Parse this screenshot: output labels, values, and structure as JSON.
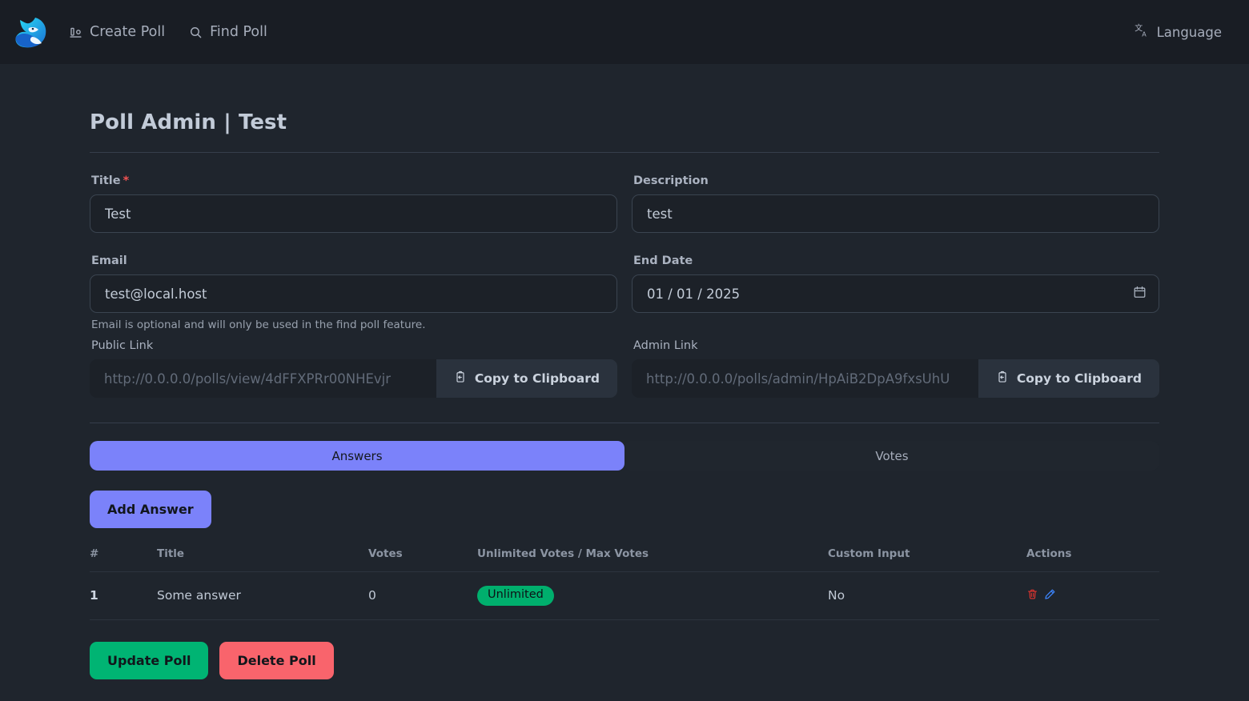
{
  "navbar": {
    "logo_name": "fox-logo",
    "links": [
      {
        "label": "Create Poll",
        "icon": "poll-bar-icon"
      },
      {
        "label": "Find Poll",
        "icon": "search-icon"
      }
    ],
    "language": {
      "label": "Language",
      "icon": "translate-icon"
    }
  },
  "page": {
    "title": "Poll Admin | Test"
  },
  "form": {
    "title": {
      "label": "Title",
      "required_marker": "*",
      "value": "Test",
      "placeholder": "Title"
    },
    "description": {
      "label": "Description",
      "value": "test",
      "placeholder": "Description"
    },
    "email": {
      "label": "Email",
      "value": "test@local.host",
      "placeholder": "Email",
      "helper": "Email is optional and will only be used in the find poll feature."
    },
    "end_date": {
      "label": "End Date",
      "value": "01 / 01 / 2025",
      "icon": "calendar-icon"
    },
    "public_link": {
      "label": "Public Link",
      "value": "http://0.0.0.0/polls/view/4dFFXPRr00NHEvjr",
      "copy_label": "Copy to Clipboard",
      "copy_icon": "clipboard-icon"
    },
    "admin_link": {
      "label": "Admin Link",
      "value": "http://0.0.0.0/polls/admin/HpAiB2DpA9fxsUhU",
      "copy_label": "Copy to Clipboard",
      "copy_icon": "clipboard-icon"
    }
  },
  "tabs": [
    {
      "label": "Answers",
      "active": true
    },
    {
      "label": "Votes",
      "active": false
    }
  ],
  "answers_panel": {
    "add_button": "Add Answer",
    "columns": [
      "#",
      "Title",
      "Votes",
      "Unlimited Votes / Max Votes",
      "Custom Input",
      "Actions"
    ],
    "rows": [
      {
        "index": "1",
        "title": "Some answer",
        "votes": "0",
        "unlimited_badge": "Unlimited",
        "custom_input": "No",
        "actions": {
          "delete_icon": "trash-icon",
          "edit_icon": "pencil-icon"
        }
      }
    ]
  },
  "footer": {
    "update_label": "Update Poll",
    "delete_label": "Delete Poll"
  },
  "colors": {
    "accent_purple": "#7b82fa",
    "success_green": "#00b473",
    "badge_green": "#00af6d",
    "danger_red": "#f9646c",
    "required_red": "#f05252",
    "trash_red": "#e3342f",
    "pencil_blue": "#3b82f6",
    "navbar_bg": "#191d24",
    "page_bg": "#1f252d",
    "input_bg": "#1c2128"
  }
}
